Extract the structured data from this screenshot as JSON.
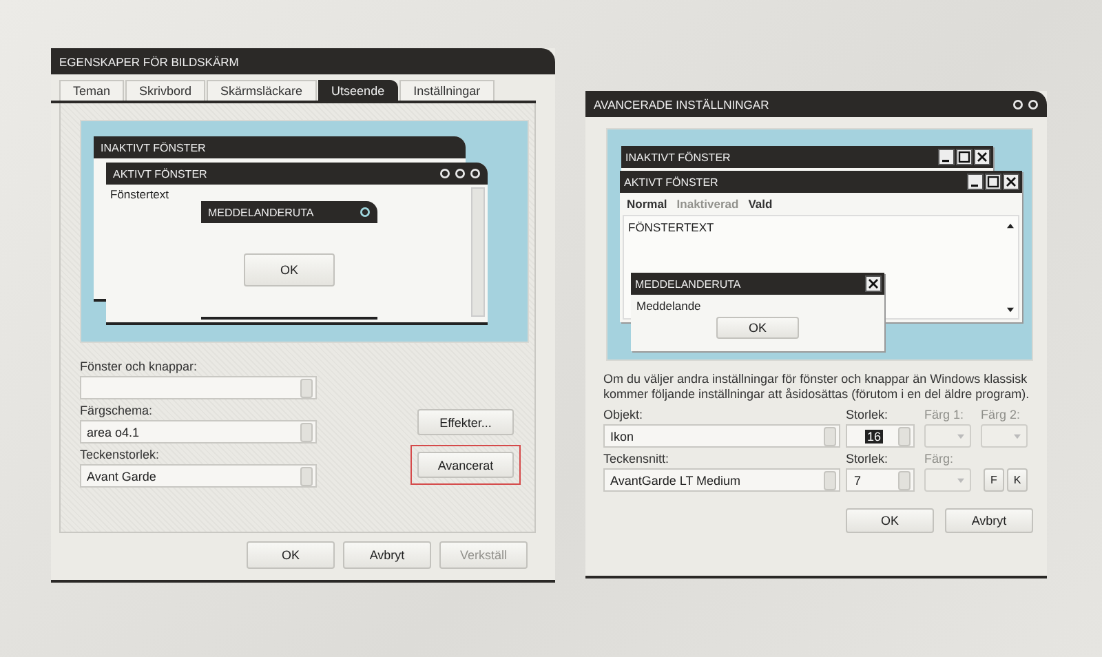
{
  "display_properties": {
    "title": "EGENSKAPER FÖR BILDSKÄRM",
    "tabs": [
      {
        "label": "Teman",
        "selected": false
      },
      {
        "label": "Skrivbord",
        "selected": false
      },
      {
        "label": "Skärmsläckare",
        "selected": false
      },
      {
        "label": "Utseende",
        "selected": true
      },
      {
        "label": "Inställningar",
        "selected": false
      }
    ],
    "preview": {
      "inactive_title": "INAKTIVT FÖNSTER",
      "active_title": "AKTIVT FÖNSTER",
      "window_text": "Fönstertext",
      "message_title": "MEDDELANDERUTA",
      "ok_button": "OK"
    },
    "fields": [
      {
        "label": "Fönster och knappar:"
      },
      {
        "label": "Färgschema:",
        "value": "area o4.1"
      },
      {
        "label": "Teckenstorlek:",
        "value": "Avant Garde"
      }
    ],
    "side_buttons": [
      {
        "label": "Effekter...",
        "highlighted": false
      },
      {
        "label": "Avancerat",
        "highlighted": true
      }
    ],
    "buttons": [
      {
        "label": "OK",
        "disabled": false
      },
      {
        "label": "Avbryt",
        "disabled": false
      },
      {
        "label": "Verkställ",
        "disabled": true
      }
    ]
  },
  "advanced": {
    "title": "AVANCERADE INSTÄLLNINGAR",
    "preview": {
      "inactive_title": "INAKTIVT FÖNSTER",
      "active_title": "AKTIVT FÖNSTER",
      "states": [
        {
          "label": "Normal",
          "disabled": false
        },
        {
          "label": "Inaktiverad",
          "disabled": true
        },
        {
          "label": "Vald",
          "disabled": false
        }
      ],
      "window_text": "FÖNSTERTEXT",
      "message_title": "MEDDELANDERUTA",
      "message_text": "Meddelande",
      "ok_button": "OK"
    },
    "note": "Om du väljer andra inställningar för fönster och knappar än Windows klassisk kommer följande inställningar att åsidosättas (förutom i en del äldre program).",
    "rows": [
      {
        "label": "Objekt:",
        "value": "Ikon",
        "size_label": "Storlek:",
        "size": "16",
        "size_selected": true,
        "color_pickers": [
          {
            "label": "Färg 1:",
            "disabled": true
          },
          {
            "label": "Färg 2:",
            "disabled": true
          }
        ]
      },
      {
        "label": "Teckensnitt:",
        "value": "AvantGarde LT Medium",
        "size_label": "Storlek:",
        "size": "7",
        "size_selected": false,
        "color_pickers": [
          {
            "label": "Färg:",
            "disabled": true
          }
        ],
        "style_buttons": [
          "F",
          "K"
        ]
      }
    ],
    "buttons": [
      {
        "label": "OK",
        "disabled": false
      },
      {
        "label": "Avbryt",
        "disabled": false
      }
    ]
  }
}
